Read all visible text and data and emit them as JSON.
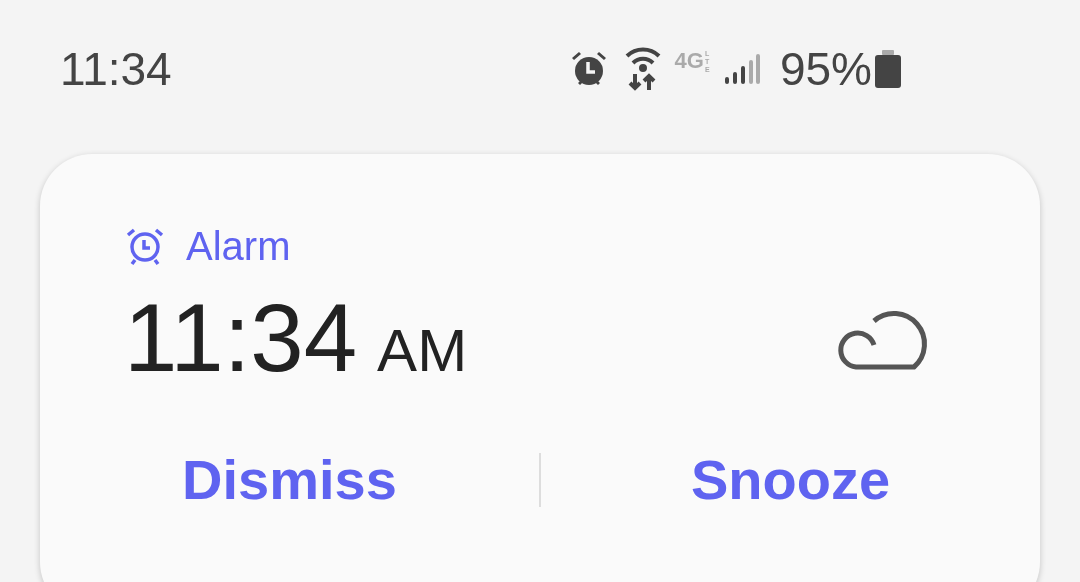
{
  "status_bar": {
    "time": "11:34",
    "network": "4G",
    "network_sub": "LTE",
    "battery": "95%"
  },
  "notification": {
    "app": "Alarm",
    "time": "11:34",
    "period": "AM",
    "actions": [
      "Dismiss",
      "Snooze"
    ]
  }
}
